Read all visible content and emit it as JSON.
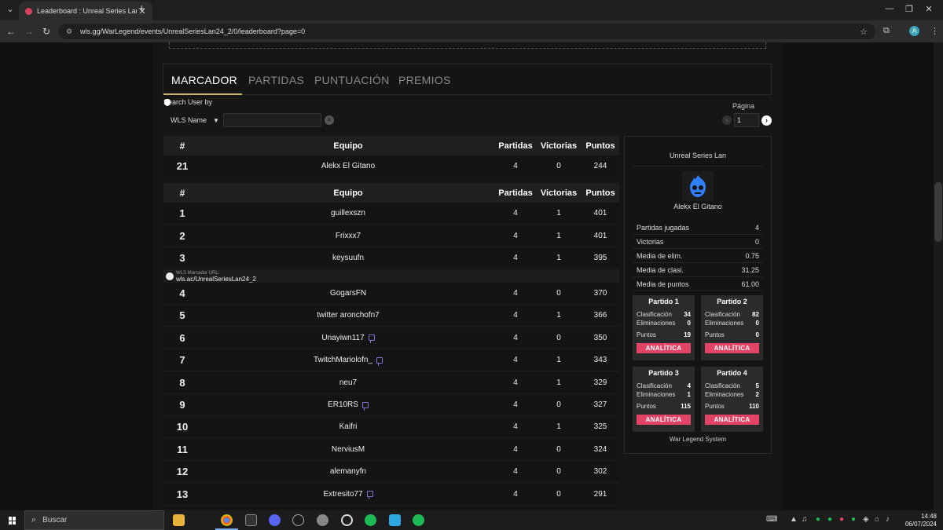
{
  "browser": {
    "tab_title": "Leaderboard : Unreal Series Lan",
    "url": "wls.gg/WarLegend/events/UnrealSeriesLan24_2/0/leaderboard?page=0",
    "profile_initial": "A"
  },
  "nav_tabs": [
    {
      "label": "MARCADOR",
      "active": true
    },
    {
      "label": "PARTIDAS",
      "active": false
    },
    {
      "label": "PUNTUACIÓN",
      "active": false
    },
    {
      "label": "PREMIOS",
      "active": false
    }
  ],
  "search": {
    "label": "Search User by",
    "field_value": "WLS Name",
    "query": ""
  },
  "pagination": {
    "label": "Página",
    "current": "1"
  },
  "table_headers": {
    "rank": "#",
    "team": "Equipo",
    "matches": "Partidas",
    "wins": "Victorias",
    "points": "Puntos"
  },
  "user_row": {
    "rank": "21",
    "team": "Alekx El Gitano",
    "matches": "4",
    "wins": "0",
    "points": "244"
  },
  "rows": [
    {
      "rank": "1",
      "team": "guillexszn",
      "matches": "4",
      "wins": "1",
      "points": "401",
      "twitch": false
    },
    {
      "rank": "2",
      "team": "Frixxx7",
      "matches": "4",
      "wins": "1",
      "points": "401",
      "twitch": false
    },
    {
      "rank": "3",
      "team": "keysuufn",
      "matches": "4",
      "wins": "1",
      "points": "395",
      "twitch": false
    },
    {
      "rank": "4",
      "team": "GogarsFN",
      "matches": "4",
      "wins": "0",
      "points": "370",
      "twitch": false
    },
    {
      "rank": "5",
      "team": "twitter aronchofn7",
      "matches": "4",
      "wins": "1",
      "points": "366",
      "twitch": false
    },
    {
      "rank": "6",
      "team": "Unayiwn117",
      "matches": "4",
      "wins": "0",
      "points": "350",
      "twitch": true
    },
    {
      "rank": "7",
      "team": "TwitchMariolofn_",
      "matches": "4",
      "wins": "1",
      "points": "343",
      "twitch": true
    },
    {
      "rank": "8",
      "team": "neu7",
      "matches": "4",
      "wins": "1",
      "points": "329",
      "twitch": false
    },
    {
      "rank": "9",
      "team": "ER10RS",
      "matches": "4",
      "wins": "0",
      "points": "327",
      "twitch": true
    },
    {
      "rank": "10",
      "team": "Kaifri",
      "matches": "4",
      "wins": "1",
      "points": "325",
      "twitch": false
    },
    {
      "rank": "11",
      "team": "NerviusM",
      "matches": "4",
      "wins": "0",
      "points": "324",
      "twitch": false
    },
    {
      "rank": "12",
      "team": "alemanyfn",
      "matches": "4",
      "wins": "0",
      "points": "302",
      "twitch": false
    },
    {
      "rank": "13",
      "team": "Extresito77",
      "matches": "4",
      "wins": "0",
      "points": "291",
      "twitch": true
    }
  ],
  "url_banner": {
    "label": "WLS Marcador URL:",
    "value": "wls.ac/UnrealSeriesLan24_2"
  },
  "side_card": {
    "event": "Unreal Series Lan",
    "player": "Alekx El Gitano",
    "stats": [
      {
        "label": "Partidas jugadas",
        "value": "4"
      },
      {
        "label": "Victorias",
        "value": "0"
      },
      {
        "label": "Media de elim.",
        "value": "0.75"
      },
      {
        "label": "Media de clasi.",
        "value": "31.25"
      },
      {
        "label": "Media de puntos",
        "value": "61.00"
      }
    ],
    "matches": [
      {
        "title": "Partido 1",
        "clasificacion": "34",
        "eliminaciones": "0",
        "puntos": "19"
      },
      {
        "title": "Partido 2",
        "clasificacion": "82",
        "eliminaciones": "0",
        "puntos": "0"
      },
      {
        "title": "Partido 3",
        "clasificacion": "4",
        "eliminaciones": "1",
        "puntos": "115"
      },
      {
        "title": "Partido 4",
        "clasificacion": "5",
        "eliminaciones": "2",
        "puntos": "110"
      }
    ],
    "labels": {
      "clasificacion": "Clasificación",
      "eliminaciones": "Eliminaciones",
      "puntos": "Puntos"
    },
    "button_label": "ANALÍTICA",
    "footer": "War Legend System"
  },
  "taskbar": {
    "search_placeholder": "Buscar",
    "time": "14:48",
    "date": "06/07/2024"
  },
  "colors": {
    "accent_gold": "#c8b46a",
    "button_red": "#e34465",
    "avatar_blue": "#2f7fff"
  }
}
